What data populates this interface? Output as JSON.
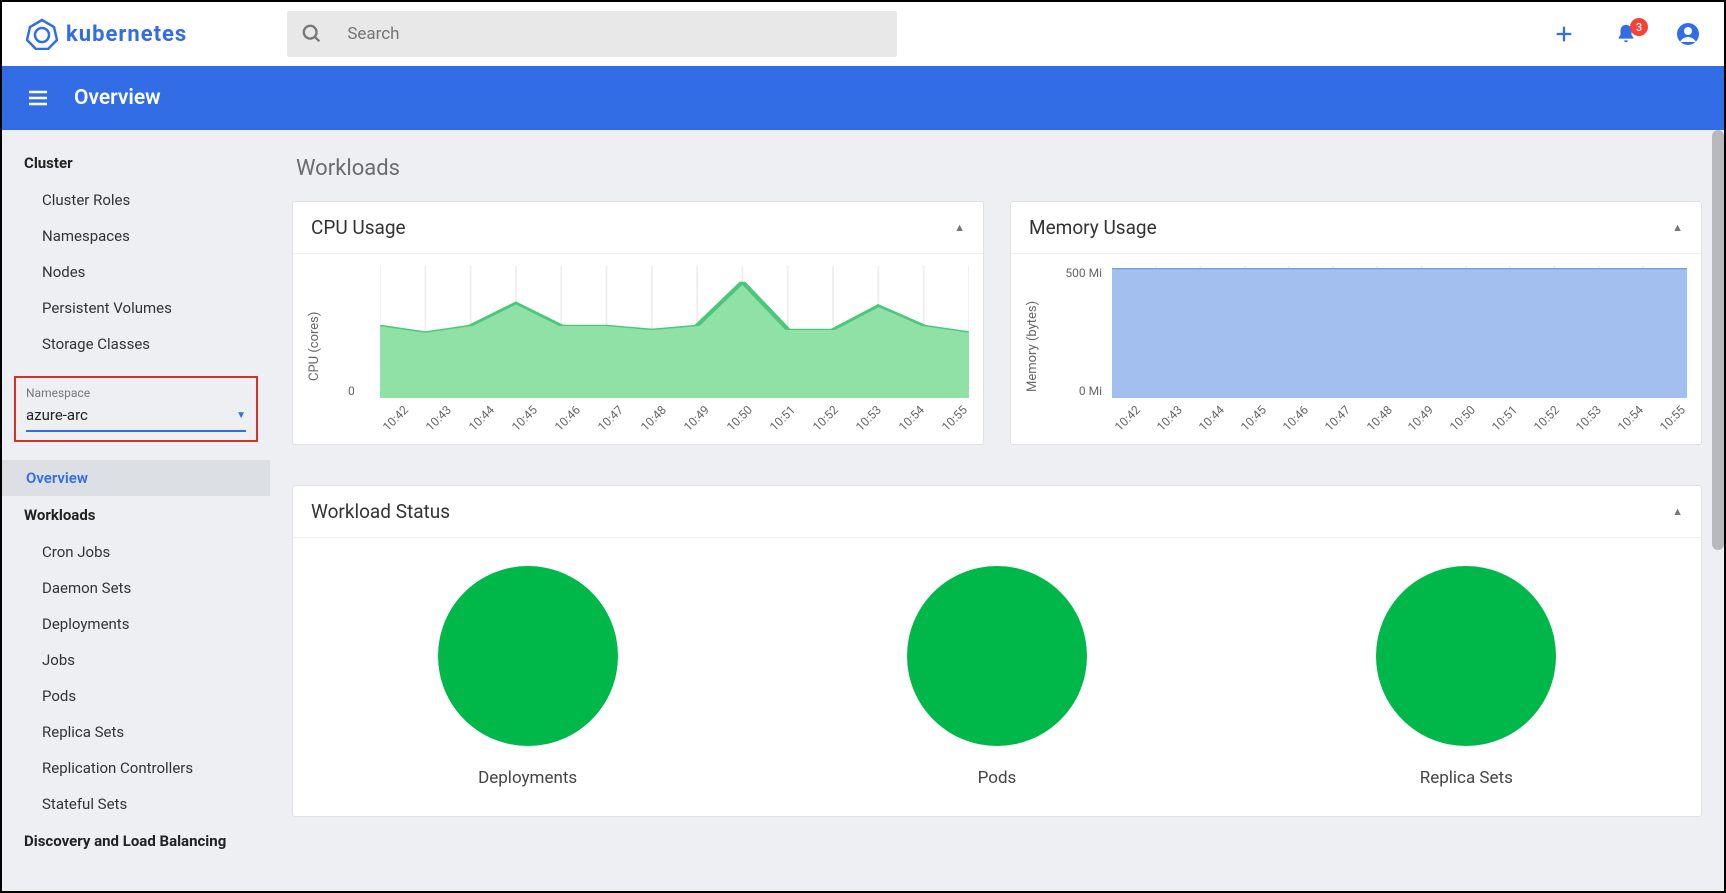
{
  "brand": "kubernetes",
  "search": {
    "placeholder": "Search"
  },
  "notifications": {
    "count": "3"
  },
  "bluebar": {
    "title": "Overview"
  },
  "sidebar": {
    "cluster_header": "Cluster",
    "cluster_items": [
      "Cluster Roles",
      "Namespaces",
      "Nodes",
      "Persistent Volumes",
      "Storage Classes"
    ],
    "namespace_label": "Namespace",
    "namespace_value": "azure-arc",
    "overview_item": "Overview",
    "workloads_header": "Workloads",
    "workloads_items": [
      "Cron Jobs",
      "Daemon Sets",
      "Deployments",
      "Jobs",
      "Pods",
      "Replica Sets",
      "Replication Controllers",
      "Stateful Sets"
    ],
    "discovery_header": "Discovery and Load Balancing"
  },
  "content": {
    "section": "Workloads",
    "cpu_card": {
      "title": "CPU Usage",
      "ylabel": "CPU (cores)"
    },
    "mem_card": {
      "title": "Memory Usage",
      "ylabel": "Memory (bytes)"
    },
    "status_card": {
      "title": "Workload Status"
    },
    "status_items": [
      "Deployments",
      "Pods",
      "Replica Sets"
    ]
  },
  "chart_data": [
    {
      "type": "area",
      "title": "CPU Usage",
      "ylabel": "CPU (cores)",
      "yticks": [
        "",
        "0"
      ],
      "categories": [
        "10:42",
        "10:43",
        "10:44",
        "10:45",
        "10:46",
        "10:47",
        "10:48",
        "10:49",
        "10:50",
        "10:51",
        "10:52",
        "10:53",
        "10:54",
        "10:55"
      ],
      "values": [
        0.55,
        0.5,
        0.55,
        0.72,
        0.55,
        0.55,
        0.52,
        0.55,
        0.88,
        0.52,
        0.52,
        0.7,
        0.55,
        0.5
      ],
      "ylim": [
        0,
        1
      ],
      "fill": "#8fe1a5",
      "stroke": "#4cc77a"
    },
    {
      "type": "area",
      "title": "Memory Usage",
      "ylabel": "Memory (bytes)",
      "yticks": [
        "500 Mi",
        "0 Mi"
      ],
      "categories": [
        "10:42",
        "10:43",
        "10:44",
        "10:45",
        "10:46",
        "10:47",
        "10:48",
        "10:49",
        "10:50",
        "10:51",
        "10:52",
        "10:53",
        "10:54",
        "10:55"
      ],
      "values": [
        490,
        490,
        490,
        490,
        490,
        490,
        490,
        490,
        490,
        490,
        490,
        490,
        490,
        490
      ],
      "ylim": [
        0,
        500
      ],
      "fill": "#a3bff0",
      "stroke": "#6f9ce8"
    }
  ]
}
